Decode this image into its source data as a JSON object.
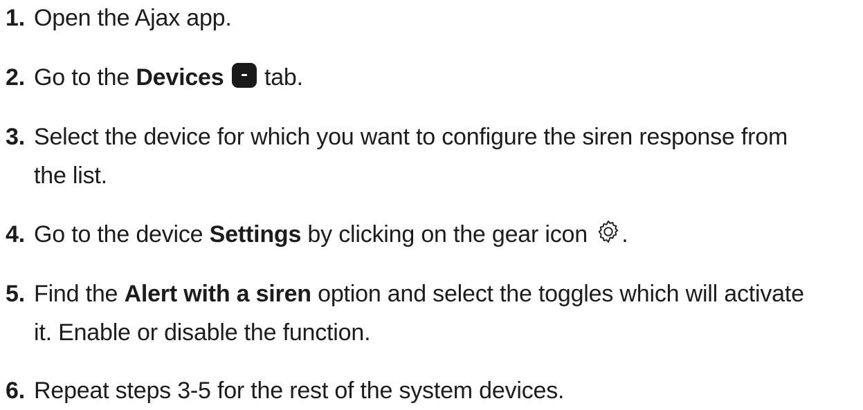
{
  "steps": [
    {
      "number": "1.",
      "text": "Open the Ajax app."
    },
    {
      "number": "2.",
      "before": "Go to the ",
      "bold": "Devices",
      "icon": "devices-tab-icon",
      "after": " tab."
    },
    {
      "number": "3.",
      "line1": "Select the device for which you want to configure the siren response from",
      "line2": "the list."
    },
    {
      "number": "4.",
      "before": "Go to the device ",
      "bold": "Settings",
      "middle": " by clicking on the gear icon ",
      "icon": "gear-icon",
      "after": "."
    },
    {
      "number": "5.",
      "before": "Find the ",
      "bold": "Alert with a siren",
      "line1_after": " option and select the toggles which will activate",
      "line2": "it. Enable or disable the function."
    },
    {
      "number": "6.",
      "text": "Repeat steps 3-5 for the rest of the system devices."
    }
  ]
}
